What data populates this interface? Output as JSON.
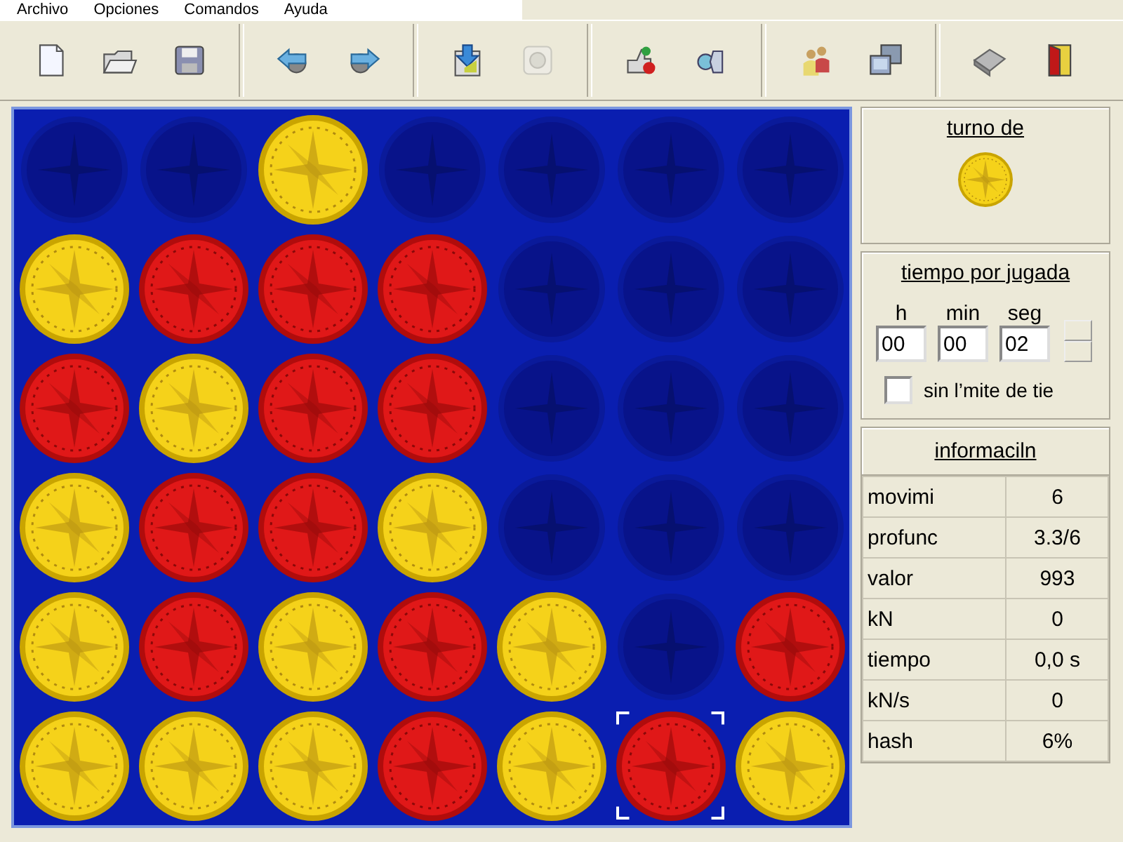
{
  "menu": [
    "Archivo",
    "Opciones",
    "Comandos",
    "Ayuda"
  ],
  "toolbar": [
    {
      "kind": "new",
      "disabled": false
    },
    {
      "kind": "open",
      "disabled": false
    },
    {
      "kind": "save",
      "disabled": false
    },
    {
      "kind": "sep"
    },
    {
      "kind": "undo",
      "disabled": false
    },
    {
      "kind": "redo",
      "disabled": false
    },
    {
      "kind": "sep"
    },
    {
      "kind": "import",
      "disabled": false
    },
    {
      "kind": "stop",
      "disabled": true
    },
    {
      "kind": "sep"
    },
    {
      "kind": "hint",
      "disabled": false
    },
    {
      "kind": "analyze",
      "disabled": false
    },
    {
      "kind": "sep"
    },
    {
      "kind": "players",
      "disabled": false
    },
    {
      "kind": "network",
      "disabled": false
    },
    {
      "kind": "sep"
    },
    {
      "kind": "help",
      "disabled": false
    },
    {
      "kind": "exit",
      "disabled": false
    }
  ],
  "board": {
    "rows": [
      [
        {
          "kind": "empty",
          "last_move": false
        },
        {
          "kind": "empty",
          "last_move": false
        },
        {
          "kind": "yellow",
          "last_move": false
        },
        {
          "kind": "empty",
          "last_move": false
        },
        {
          "kind": "empty",
          "last_move": false
        },
        {
          "kind": "empty",
          "last_move": false
        },
        {
          "kind": "empty",
          "last_move": false
        }
      ],
      [
        {
          "kind": "yellow",
          "last_move": false
        },
        {
          "kind": "red",
          "last_move": false
        },
        {
          "kind": "red",
          "last_move": false
        },
        {
          "kind": "red",
          "last_move": false
        },
        {
          "kind": "empty",
          "last_move": false
        },
        {
          "kind": "empty",
          "last_move": false
        },
        {
          "kind": "empty",
          "last_move": false
        }
      ],
      [
        {
          "kind": "red",
          "last_move": false
        },
        {
          "kind": "yellow",
          "last_move": false
        },
        {
          "kind": "red",
          "last_move": false
        },
        {
          "kind": "red",
          "last_move": false
        },
        {
          "kind": "empty",
          "last_move": false
        },
        {
          "kind": "empty",
          "last_move": false
        },
        {
          "kind": "empty",
          "last_move": false
        }
      ],
      [
        {
          "kind": "yellow",
          "last_move": false
        },
        {
          "kind": "red",
          "last_move": false
        },
        {
          "kind": "red",
          "last_move": false
        },
        {
          "kind": "yellow",
          "last_move": false
        },
        {
          "kind": "empty",
          "last_move": false
        },
        {
          "kind": "empty",
          "last_move": false
        },
        {
          "kind": "empty",
          "last_move": false
        }
      ],
      [
        {
          "kind": "yellow",
          "last_move": false
        },
        {
          "kind": "red",
          "last_move": false
        },
        {
          "kind": "yellow",
          "last_move": false
        },
        {
          "kind": "red",
          "last_move": false
        },
        {
          "kind": "yellow",
          "last_move": false
        },
        {
          "kind": "empty",
          "last_move": false
        },
        {
          "kind": "red",
          "last_move": false
        }
      ],
      [
        {
          "kind": "yellow",
          "last_move": false
        },
        {
          "kind": "yellow",
          "last_move": false
        },
        {
          "kind": "yellow",
          "last_move": false
        },
        {
          "kind": "red",
          "last_move": false
        },
        {
          "kind": "yellow",
          "last_move": false
        },
        {
          "kind": "red",
          "last_move": true
        },
        {
          "kind": "yellow",
          "last_move": false
        }
      ]
    ]
  },
  "turn": {
    "title": "turno de",
    "disc": {
      "kind": "yellow"
    }
  },
  "time": {
    "title": "tiempo por jugada",
    "fields": [
      {
        "label": "h",
        "value": "00"
      },
      {
        "label": "min",
        "value": "00"
      },
      {
        "label": "seg",
        "value": "02"
      }
    ],
    "no_limit": {
      "label": "sin l’mite de tie",
      "checked": false
    }
  },
  "info": {
    "title": "informaciln",
    "rows": [
      {
        "label": "movimi",
        "value": "6"
      },
      {
        "label": "profunc",
        "value": "3.3/6"
      },
      {
        "label": "valor",
        "value": "993"
      },
      {
        "label": "kN",
        "value": "0"
      },
      {
        "label": "tiempo",
        "value": "0,0 s"
      },
      {
        "label": "kN/s",
        "value": "0"
      },
      {
        "label": "hash",
        "value": "6%"
      }
    ]
  }
}
